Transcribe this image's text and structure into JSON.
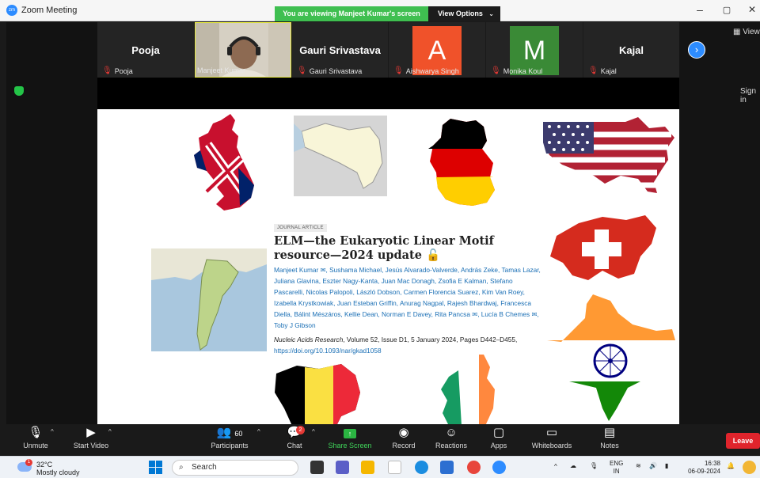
{
  "window": {
    "title": "Zoom Meeting",
    "viewing_banner": "You are viewing Manjeet Kumar's screen",
    "view_options": "View Options",
    "controls": {
      "minimize": "–",
      "restore": "▢",
      "close": "✕"
    }
  },
  "participants_strip": {
    "tiles": [
      {
        "big_name": "Pooja",
        "label": "Pooja",
        "type": "name"
      },
      {
        "big_name": "",
        "label": "Manjeet Kumar",
        "type": "video"
      },
      {
        "big_name": "Gauri Srivastava",
        "label": "Gauri Srivastava",
        "type": "name"
      },
      {
        "big_name": "A",
        "label": "Aishwarya Singh",
        "type": "avatar",
        "color": "#f0522a"
      },
      {
        "big_name": "M",
        "label": "Monika Koul",
        "type": "avatar",
        "color": "#3a8a36"
      },
      {
        "big_name": "Kajal",
        "label": "Kajal",
        "type": "name"
      }
    ],
    "view_label": "View",
    "sign_in": "Sign in"
  },
  "shared_slide": {
    "journal_tag": "JOURNAL ARTICLE",
    "title": "ELM—the Eukaryotic Linear Motif resource—2024 update",
    "open_access_icon": "🔓",
    "authors": "Manjeet Kumar ✉, Sushama Michael, Jesús Alvarado-Valverde, András Zeke, Tamas Lazar, Juliana Glavina, Eszter Nagy-Kanta, Juan Mac Donagh, Zsofia E Kalman, Stefano Pascarelli, Nicolas Palopoli, László Dobson, Carmen Florencia Suarez, Kim Van Roey, Izabella Krystkowiak, Juan Esteban Griffin, Anurag Nagpal, Rajesh Bhardwaj, Francesca Diella, Bálint Mészáros, Kellie Dean, Norman E Davey, Rita Pancsa ✉, Lucía B Chemes ✉, Toby J Gibson",
    "journal": "Nucleic Acids Research",
    "citation_rest": ", Volume 52, Issue D1, 5 January 2024, Pages D442–D455,",
    "doi": "https://doi.org/10.1093/nar/gkad1058"
  },
  "toolbar": {
    "unmute": "Unmute",
    "start_video": "Start Video",
    "participants": "Participants",
    "participant_count": "60",
    "chat": "Chat",
    "chat_badge": "2",
    "share_screen": "Share Screen",
    "record": "Record",
    "reactions": "Reactions",
    "apps": "Apps",
    "whiteboards": "Whiteboards",
    "notes": "Notes",
    "leave": "Leave"
  },
  "taskbar": {
    "weather_temp": "32°C",
    "weather_desc": "Mostly cloudy",
    "weather_badge": "1",
    "search_placeholder": "Search",
    "lang_top": "ENG",
    "lang_bottom": "IN",
    "time": "16:38",
    "date": "06-09-2024"
  },
  "colors": {
    "zoom_blue": "#2d8cff",
    "banner_green": "#3fbf50",
    "leave_red": "#e0242c"
  }
}
